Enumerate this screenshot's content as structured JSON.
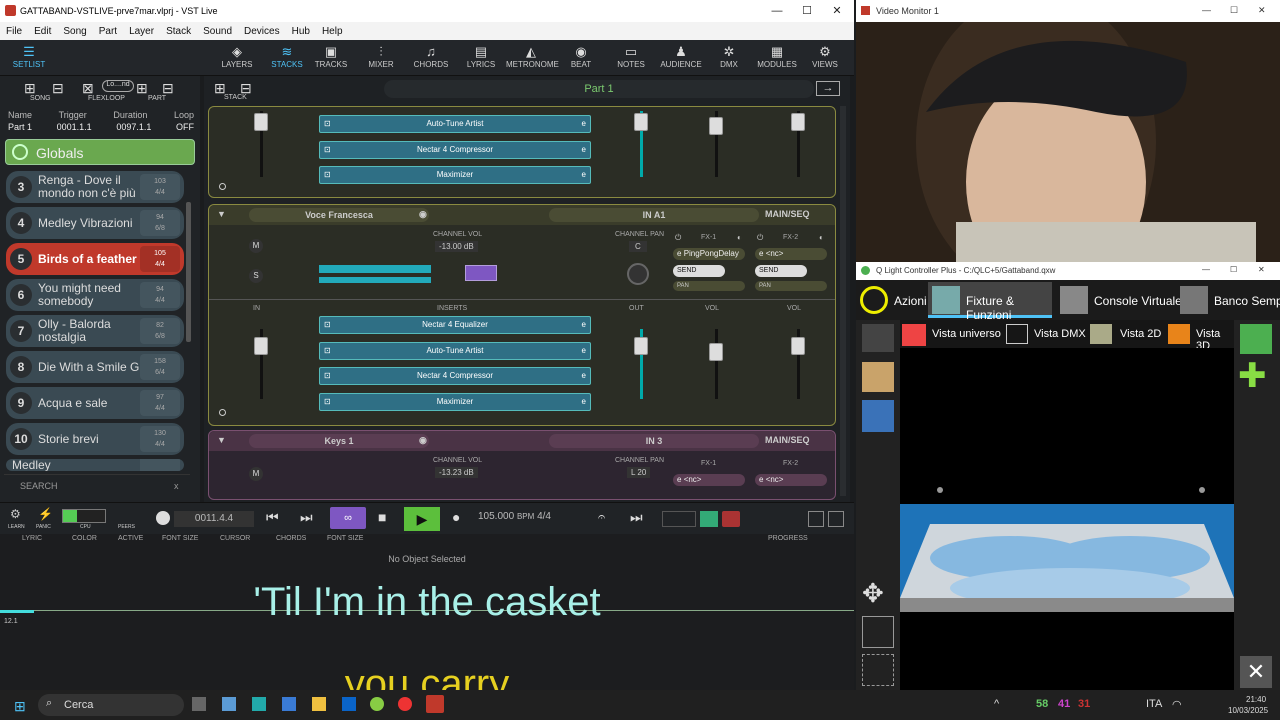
{
  "vst": {
    "title": "GATTABAND-VSTLIVE-prve7mar.vlprj - VST Live",
    "menu": [
      "File",
      "Edit",
      "Song",
      "Part",
      "Layer",
      "Stack",
      "Sound",
      "Devices",
      "Hub",
      "Help"
    ],
    "toolbar": [
      "LAYERS",
      "STACKS",
      "TRACKS",
      "MIXER",
      "CHORDS",
      "LYRICS",
      "METRONOME",
      "BEAT",
      "NOTES",
      "AUDIENCE",
      "DMX",
      "MODULES",
      "VIEWS"
    ],
    "setlist_label": "SETLIST",
    "song_label": "SONG",
    "flexloop_label": "FLEXLOOP",
    "part_label": "PART",
    "loop_field": "Lo....nd",
    "stack_label": "STACK",
    "info_headers": [
      "Name",
      "Trigger",
      "Duration",
      "Loop"
    ],
    "info_values": [
      "Part 1",
      "0001.1.1",
      "0097.1.1",
      "OFF"
    ],
    "globals": "Globals",
    "songs": [
      {
        "num": "3",
        "name": "Renga - Dove il mondo non c'è più",
        "bpm": "103",
        "sig": "4/4"
      },
      {
        "num": "4",
        "name": "Medley Vibrazioni",
        "bpm": "94",
        "sig": "6/8"
      },
      {
        "num": "5",
        "name": "Birds of a feather",
        "bpm": "105",
        "sig": "4/4"
      },
      {
        "num": "6",
        "name": "You might need somebody",
        "bpm": "94",
        "sig": "4/4"
      },
      {
        "num": "7",
        "name": "Olly - Balorda nostalgia",
        "bpm": "82",
        "sig": "6/8"
      },
      {
        "num": "8",
        "name": "Die With a Smile G",
        "bpm": "158",
        "sig": "6/4"
      },
      {
        "num": "9",
        "name": "Acqua e sale",
        "bpm": "97",
        "sig": "4/4"
      },
      {
        "num": "10",
        "name": "Storie brevi",
        "bpm": "130",
        "sig": "4/4"
      },
      {
        "num": "",
        "name": "Medley",
        "bpm": "",
        "sig": ""
      }
    ],
    "search": "SEARCH",
    "part_title": "Part 1",
    "inserts_top": [
      "Auto-Tune Artist",
      "Nectar 4 Compressor",
      "Maximizer"
    ],
    "track1": {
      "name": "Voce Francesca",
      "input": "IN A1",
      "out": "MAIN/SEQ",
      "vol_label": "CHANNEL VOL",
      "vol": "-13.00 dB",
      "pan_label": "CHANNEL PAN",
      "pan": "C",
      "fx1": "FX-1",
      "fx2": "FX-2",
      "fx1_val": "PingPongDelay",
      "fx2_val": "<nc>",
      "send": "SEND",
      "pan_small": "PAN",
      "in": "IN",
      "inserts": "INSERTS",
      "out_lbl": "OUT",
      "vol_lbl": "VOL",
      "insert_list": [
        "Nectar 4 Equalizer",
        "Auto-Tune Artist",
        "Nectar 4 Compressor",
        "Maximizer"
      ]
    },
    "track2": {
      "name": "Keys 1",
      "input": "IN 3",
      "out": "MAIN/SEQ",
      "vol_label": "CHANNEL VOL",
      "vol": "-13.23 dB",
      "pan_label": "CHANNEL PAN",
      "pan": "L 20",
      "fx1": "FX-1",
      "fx2": "FX-2",
      "fx1_val": "<nc>",
      "fx2_val": "<nc>"
    },
    "transport": {
      "learn": "LEARN",
      "panic": "PANIC",
      "cpu": "CPU",
      "peers": "PEERS",
      "position": "0011.4.4",
      "tempo": "105.000",
      "bpm": "BPM",
      "sig": "4/4"
    },
    "lyric_cols": [
      "LYRIC",
      "COLOR",
      "ACTIVE",
      "FONT SIZE",
      "CURSOR",
      "CHORDS",
      "FONT SIZE",
      "PROGRESS"
    ],
    "no_object": "No Object Selected",
    "lyric_line1": "'Til I'm in the casket",
    "lyric_line2": "you carry",
    "ruler": "12.1",
    "e": "e"
  },
  "video": {
    "title": "Video Monitor 1"
  },
  "qlc": {
    "title": "Q Light Controller Plus - C:/QLC+5/Gattaband.qxw",
    "tabs": [
      "Azioni",
      "Fixture & Funzioni",
      "Console Virtuale",
      "Banco Sempli"
    ],
    "subtabs": [
      "Vista universo",
      "Vista DMX",
      "Vista 2D",
      "Vista 3D"
    ]
  },
  "taskbar": {
    "search": "Cerca",
    "time": "21:40",
    "date": "10/03/2025",
    "lang": "ITA",
    "n1": "58",
    "n2": "41",
    "n3": "31"
  },
  "colors": {
    "accent": "#4fc3f7",
    "selected": "#c0392b",
    "globals": "#6aa84f"
  }
}
